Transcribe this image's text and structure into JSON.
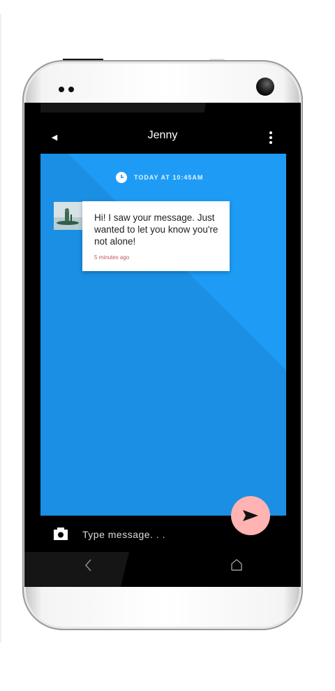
{
  "header": {
    "title": "Jenny",
    "back_icon": "back-triangle-icon",
    "menu_icon": "more-vert-icon"
  },
  "chat": {
    "timestamp": "TODAY AT 10:45AM",
    "timestamp_icon": "clock-icon",
    "messages": [
      {
        "text": "Hi! I saw your message. Just wanted to let you know you're not alone!",
        "time": "5 minutes ago",
        "avatar": "avatar-photo"
      }
    ]
  },
  "composer": {
    "placeholder": "Type message. . .",
    "camera_icon": "camera-icon",
    "send_icon": "send-icon"
  },
  "nav": {
    "back_icon": "nav-back-icon",
    "home_icon": "nav-home-icon"
  },
  "colors": {
    "chat_background": "#1a8fe3",
    "chat_background_light": "#1e9cf5",
    "send_button": "#ffb3b3",
    "timestamp_text": "#e3f1ff",
    "message_time": "#c0565a"
  }
}
